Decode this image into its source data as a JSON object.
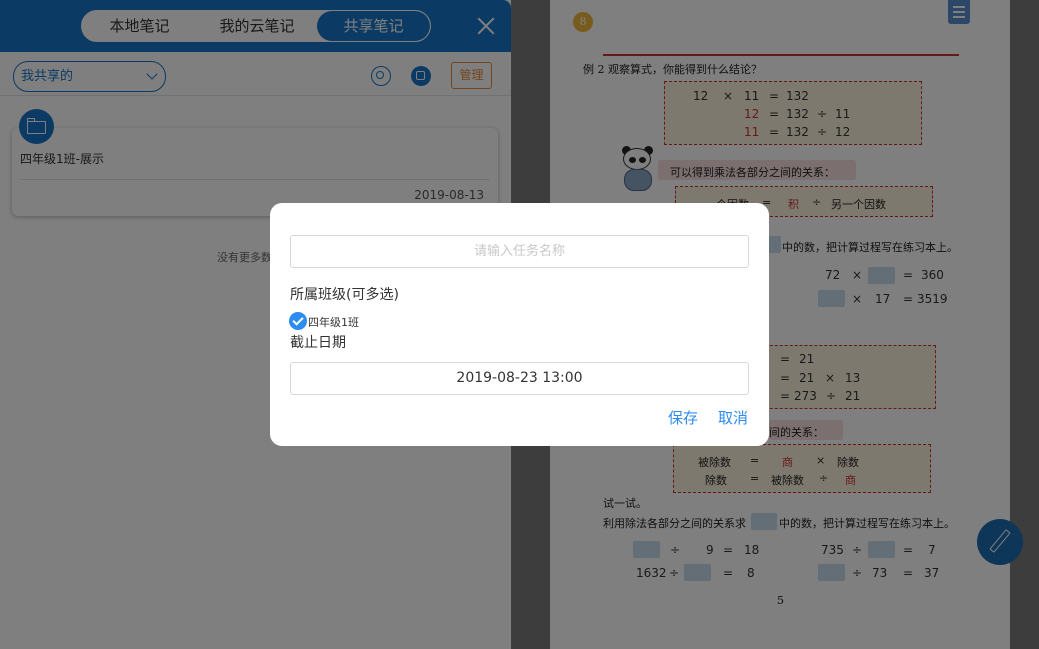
{
  "tabs": [
    {
      "label": "本地笔记",
      "active": false
    },
    {
      "label": "我的云笔记",
      "active": false
    },
    {
      "label": "共享笔记",
      "active": true
    }
  ],
  "filter": {
    "selected": "我共享的"
  },
  "toolbar": {
    "manage_label": "管理",
    "search_icon": "search-icon",
    "share_icon": "share-icon"
  },
  "notes": [
    {
      "title": "四年级1班-展示",
      "date": "2019-08-13"
    }
  ],
  "list_footer": "没有更多数",
  "book": {
    "badge": "8",
    "example_title": "例 2  观察算式，你能得到什么结论？",
    "eq1": [
      "12",
      "×",
      "11",
      "=",
      "132"
    ],
    "eq2": [
      "12",
      "=",
      "132",
      "÷",
      "11"
    ],
    "eq3": [
      "11",
      "=",
      "132",
      "÷",
      "12"
    ],
    "relation_mul": "可以得到乘法各部分之间的关系：",
    "rule_mul": [
      "一个因数",
      "=",
      "积",
      "÷",
      "另一个因数"
    ],
    "exercise_line": "中的数，把计算过程写在练习本上。",
    "ex1": [
      "72",
      "×",
      "=",
      "360"
    ],
    "ex2": [
      "×",
      "17",
      "=",
      "3519"
    ],
    "div_eq1": [
      "=",
      "21"
    ],
    "div_eq2": [
      "=",
      "21",
      "×",
      "13"
    ],
    "div_eq3": [
      "=",
      "273",
      "÷",
      "21"
    ],
    "relation_div": "间的关系：",
    "rule_div1": [
      "被除数",
      "=",
      "商",
      "×",
      "除数"
    ],
    "rule_div2": [
      "除数",
      "=",
      "被除数",
      "÷",
      "商"
    ],
    "try_label": "试一试。",
    "try_line": "利用除法各部分之间的关系求",
    "try_line_end": "中的数，把计算过程写在练习本上。",
    "try1": [
      "÷",
      "9",
      "=",
      "18"
    ],
    "try2": [
      "735",
      "÷",
      "=",
      "7"
    ],
    "try3": [
      "1632",
      "÷",
      "=",
      "8"
    ],
    "try4": [
      "÷",
      "73",
      "=",
      "37"
    ],
    "page_number": "5"
  },
  "dialog": {
    "task_placeholder": "请输入任务名称",
    "task_value": "",
    "class_label": "所属班级(可多选)",
    "class_option": "四年级1班",
    "class_checked": true,
    "deadline_label": "截止日期",
    "deadline_value": "2019-08-23 13:00",
    "save_label": "保存",
    "cancel_label": "取消"
  },
  "colors": {
    "accent": "#1677c8",
    "manage": "#e98b3c",
    "dialog_action": "#2c8cf0"
  }
}
